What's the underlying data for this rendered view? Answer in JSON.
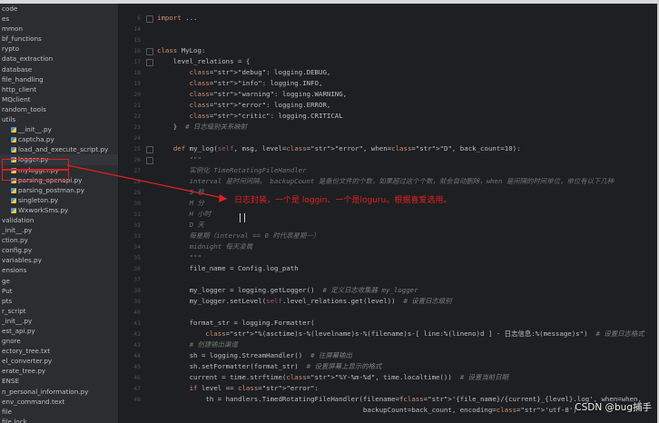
{
  "sidebar": {
    "items": [
      {
        "label": "code",
        "icon": "folder-icon"
      },
      {
        "label": "es",
        "icon": "folder-icon"
      },
      {
        "label": "mmon",
        "icon": "folder-icon"
      },
      {
        "label": "bf_functions",
        "icon": "folder-icon"
      },
      {
        "label": "rypto",
        "icon": "folder-icon"
      },
      {
        "label": "data_extraction",
        "icon": "folder-icon"
      },
      {
        "label": "database",
        "icon": "folder-icon"
      },
      {
        "label": "file_handling",
        "icon": "folder-icon"
      },
      {
        "label": "http_client",
        "icon": "folder-icon"
      },
      {
        "label": "MQclient",
        "icon": "folder-icon"
      },
      {
        "label": "random_tools",
        "icon": "folder-icon"
      },
      {
        "label": "utils",
        "icon": "folder-icon"
      },
      {
        "label": "__init__.py",
        "icon": "python-file-icon"
      },
      {
        "label": "captcha.py",
        "icon": "python-file-icon"
      },
      {
        "label": "load_and_execute_script.py",
        "icon": "python-file-icon"
      },
      {
        "label": "logger.py",
        "icon": "python-file-icon",
        "selected": true
      },
      {
        "label": "mylogger.py",
        "icon": "python-file-icon"
      },
      {
        "label": "parsing_openapi.py",
        "icon": "python-file-icon"
      },
      {
        "label": "parsing_postman.py",
        "icon": "python-file-icon"
      },
      {
        "label": "singleton.py",
        "icon": "python-file-icon"
      },
      {
        "label": "WxworkSms.py",
        "icon": "python-file-icon"
      },
      {
        "label": "validation",
        "icon": "folder-icon"
      },
      {
        "label": "_init__.py",
        "icon": "python-file-icon"
      },
      {
        "label": "ction.py",
        "icon": "python-file-icon"
      },
      {
        "label": "config.py",
        "icon": "python-file-icon"
      },
      {
        "label": "variables.py",
        "icon": "python-file-icon"
      },
      {
        "label": "ensions",
        "icon": "folder-icon"
      },
      {
        "label": "ge",
        "icon": "folder-icon"
      },
      {
        "label": "Put",
        "icon": "folder-icon"
      },
      {
        "label": "pts",
        "icon": "folder-icon"
      },
      {
        "label": "r_script",
        "icon": "folder-icon"
      },
      {
        "label": "_init__.py",
        "icon": "python-file-icon"
      },
      {
        "label": "est_api.py",
        "icon": "python-file-icon"
      },
      {
        "label": "gnore",
        "icon": "file-icon"
      },
      {
        "label": "ectory_tree.txt",
        "icon": "file-icon"
      },
      {
        "label": "el_converter.py",
        "icon": "python-file-icon"
      },
      {
        "label": "erate_tree.py",
        "icon": "python-file-icon"
      },
      {
        "label": "ENSE",
        "icon": "file-icon"
      },
      {
        "label": "n_personal_information.py",
        "icon": "python-file-icon"
      },
      {
        "label": "env_command.text",
        "icon": "file-icon"
      },
      {
        "label": "file",
        "icon": "file-icon"
      },
      {
        "label": "file.lock",
        "icon": "file-icon"
      }
    ]
  },
  "editor": {
    "line_numbers": [
      "6",
      "14",
      "15",
      "16",
      "17",
      "18",
      "19",
      "20",
      "21",
      "22",
      "23",
      "24",
      "25",
      "26",
      "27",
      "28",
      "29",
      "30",
      "31",
      "32",
      "33",
      "34",
      "35",
      "36",
      "37",
      "38",
      "39",
      "40",
      "41",
      "42",
      "43",
      "44",
      "45",
      "46",
      "47",
      "48"
    ],
    "lines": [
      {
        "text": "import ..."
      },
      {
        "text": ""
      },
      {
        "text": ""
      },
      {
        "text": "class MyLog:"
      },
      {
        "text": "    level_relations = {"
      },
      {
        "text": "        \"debug\": logging.DEBUG,"
      },
      {
        "text": "        \"info\": logging.INFO,"
      },
      {
        "text": "        \"warning\": logging.WARNING,"
      },
      {
        "text": "        \"error\": logging.ERROR,"
      },
      {
        "text": "        \"critic\": logging.CRITICAL"
      },
      {
        "text": "    }  # 日志级别关系映射"
      },
      {
        "text": ""
      },
      {
        "text": "    def my_log(self, msg, level=\"error\", when=\"D\", back_count=10):"
      },
      {
        "text": "        \"\"\""
      },
      {
        "text": "        实例化 TimeRotatingFileHandler"
      },
      {
        "text": "        interval 是时间间隔， backupCount 是备份文件的个数，如果超过这个个数，就会自动删除，when 是间隔的时间单位，单位有以下几种"
      },
      {
        "text": "        S 秒"
      },
      {
        "text": "        M 分"
      },
      {
        "text": "        H 小时"
      },
      {
        "text": "        D 天"
      },
      {
        "text": "        每星期（interval == 0 时代表星期一）"
      },
      {
        "text": "        midnight 每天凌晨"
      },
      {
        "text": "        \"\"\""
      },
      {
        "text": "        file_name = Config.log_path"
      },
      {
        "text": ""
      },
      {
        "text": "        my_logger = logging.getLogger()  # 定义日志收集器 my_logger"
      },
      {
        "text": "        my_logger.setLevel(self.level_relations.get(level))  # 设置日志级别"
      },
      {
        "text": ""
      },
      {
        "text": "        format_str = logging.Formatter("
      },
      {
        "text": "            \"%(asctime)s-%(levelname)s-%(filename)s-[ line:%(lineno)d ] - 日志信息:%(message)s\")  # 设置日志格式"
      },
      {
        "text": "        # 创建输出渠道"
      },
      {
        "text": "        sh = logging.StreamHandler()  # 往屏幕输出"
      },
      {
        "text": "        sh.setFormatter(format_str)  # 设置屏幕上显示的格式"
      },
      {
        "text": "        current = time.strftime(\"%Y-%m-%d\", time.localtime())  # 设置当前日期"
      },
      {
        "text": "        if level == \"error\":"
      },
      {
        "text": "            th = handlers.TimedRotatingFileHandler(filename=f'{file_name}/{current}_{level}.log', when=when,"
      },
      {
        "text": "                                                   backupCount=back_count, encoding='utf-8')"
      }
    ]
  },
  "annotation": {
    "text": "日志封装，一个是   loggin、一个是loguru。根据喜爱选用。"
  },
  "watermark": {
    "text": "CSDN @bug捕手"
  },
  "colors": {
    "annotation": "#e02020",
    "background": "#1e1f22",
    "sidebar": "#2b2d30"
  }
}
